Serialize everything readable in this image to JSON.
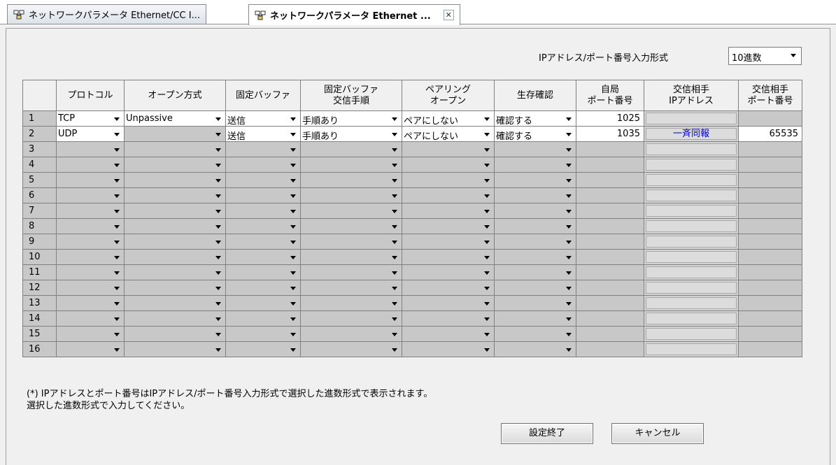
{
  "tabs": [
    {
      "label": "ネットワークパラメータ Ethernet/CC I..."
    },
    {
      "label": "ネットワークパラメータ Ethernet ..."
    }
  ],
  "format": {
    "label": "IPアドレス/ポート番号入力形式",
    "value": "10進数"
  },
  "columns": {
    "no": "",
    "protocol": "プロトコル",
    "open": "オープン方式",
    "buffer": "固定バッファ",
    "procedure": "固定バッファ\n交信手順",
    "pairing": "ペアリング\nオープン",
    "alive": "生存確認",
    "local_port": "自局\nポート番号",
    "remote_ip": "交信相手\nIPアドレス",
    "remote_port": "交信相手\nポート番号"
  },
  "rows": [
    {
      "no": "1",
      "protocol": "TCP",
      "open": "Unpassive",
      "buffer": "送信",
      "procedure": "手順あり",
      "pairing": "ペアにしない",
      "alive": "確認する",
      "local_port": "1025",
      "remote_ip": "",
      "remote_port": ""
    },
    {
      "no": "2",
      "protocol": "UDP",
      "open": "",
      "buffer": "送信",
      "procedure": "手順あり",
      "pairing": "ペアにしない",
      "alive": "確認する",
      "local_port": "1035",
      "remote_ip": "一斉同報",
      "remote_port": "65535"
    },
    {
      "no": "3"
    },
    {
      "no": "4"
    },
    {
      "no": "5"
    },
    {
      "no": "6"
    },
    {
      "no": "7"
    },
    {
      "no": "8"
    },
    {
      "no": "9"
    },
    {
      "no": "10"
    },
    {
      "no": "11"
    },
    {
      "no": "12"
    },
    {
      "no": "13"
    },
    {
      "no": "14"
    },
    {
      "no": "15"
    },
    {
      "no": "16"
    }
  ],
  "notes": {
    "line1": "(*) IPアドレスとポート番号はIPアドレス/ポート番号入力形式で選択した進数形式で表示されます。",
    "line2": "選択した進数形式で入力してください。"
  },
  "buttons": {
    "finish": "設定終了",
    "cancel": "キャンセル"
  }
}
